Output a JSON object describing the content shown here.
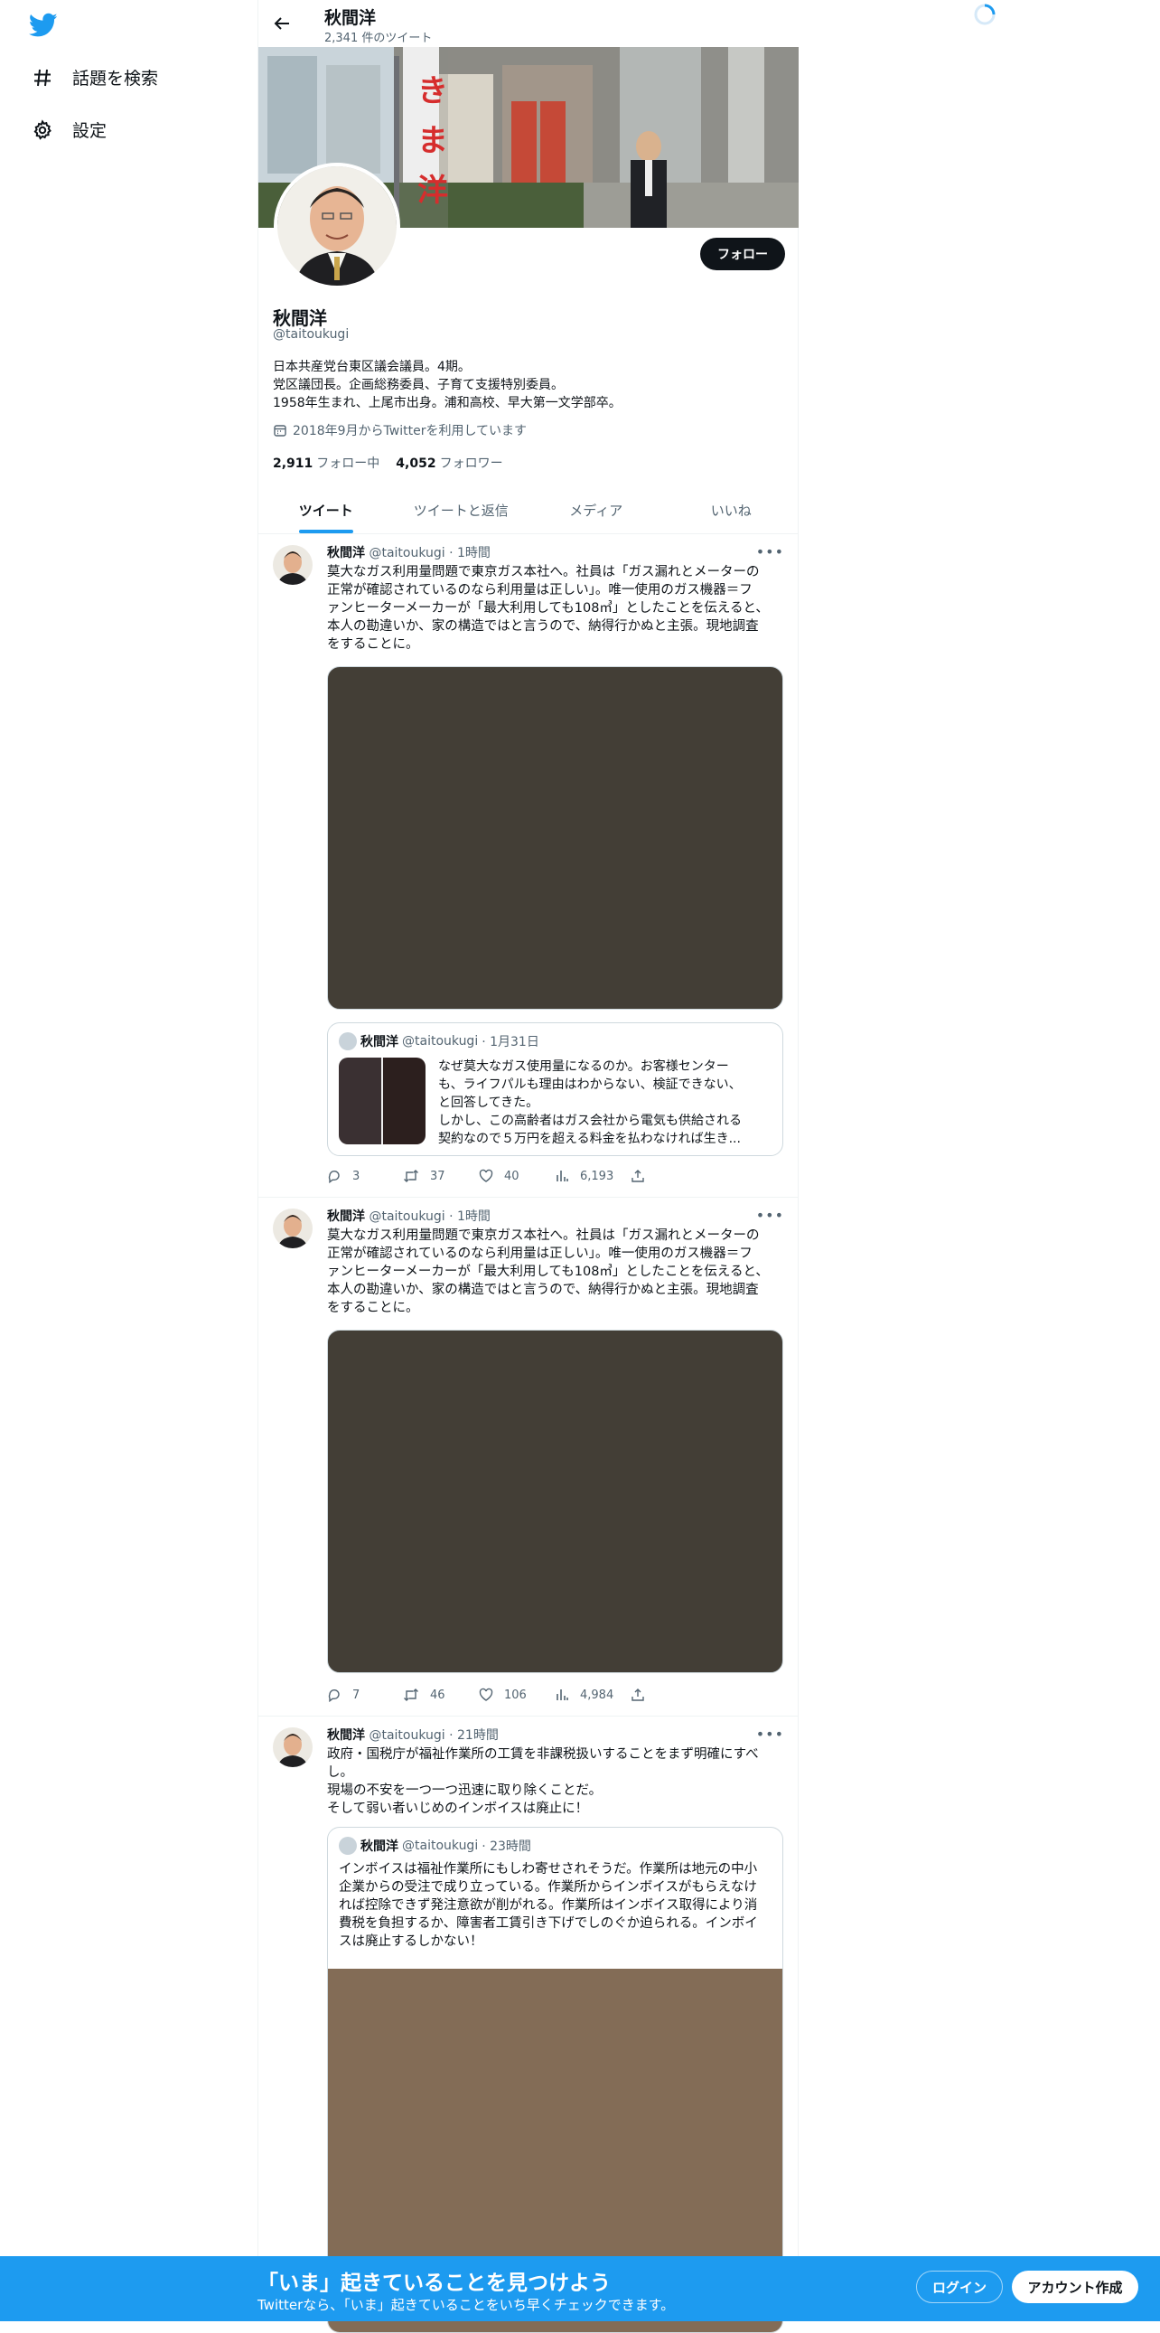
{
  "sidebar": {
    "items": [
      {
        "label": "話題を検索",
        "icon": "hashtag-icon"
      },
      {
        "label": "設定",
        "icon": "gear-icon"
      }
    ]
  },
  "header": {
    "name": "秋間洋",
    "tweet_count": "2,341 件のツイート"
  },
  "profile": {
    "follow_label": "フォロー",
    "name": "秋間洋",
    "handle": "@taitoukugi",
    "bio": [
      "日本共産党台東区議会議員。4期。",
      "党区議団長。企画総務委員、子育て支援特別委員。",
      "1958年生まれ、上尾市出身。浦和高校、早大第一文学部卒。"
    ],
    "joined": "2018年9月からTwitterを利用しています",
    "following_count": "2,911",
    "following_label": "フォロー中",
    "followers_count": "4,052",
    "followers_label": "フォロワー",
    "banner_flag_text": "き ま 洋"
  },
  "tabs": [
    {
      "label": "ツイート",
      "active": true
    },
    {
      "label": "ツイートと返信",
      "active": false
    },
    {
      "label": "メディア",
      "active": false
    },
    {
      "label": "いいね",
      "active": false
    }
  ],
  "tweets": [
    {
      "name": "秋間洋",
      "handle": "@taitoukugi",
      "time": "· 1時間",
      "lines": [
        "莫大なガス利用量問題で東京ガス本社へ。社員は「ガス漏れとメーターの",
        "正常が確認されているのなら利用量は正しい」。唯一使用のガス機器＝フ",
        "ァンヒーターメーカーが「最大利用しても108㎥」としたことを伝えると、",
        "本人の勘違いか、家の構造ではと言うので、納得行かぬと主張。現地調査",
        "をすることに。"
      ],
      "media_color": "#433e36",
      "quote": {
        "name": "秋間洋",
        "handle": "@taitoukugi",
        "time": "· 1月31日",
        "lines": [
          "なぜ莫大なガス使用量になるのか。お客様センター",
          "も、ライフパルも理由はわからない、検証できない、",
          "と回答してきた。",
          "しかし、この高齢者はガス会社から電気も供給される",
          "契約なので５万円を超える料金を払わなければ生き..."
        ]
      },
      "replies": "3",
      "retweets": "37",
      "likes": "40",
      "views": "6,193"
    },
    {
      "name": "秋間洋",
      "handle": "@taitoukugi",
      "time": "· 1時間",
      "lines": [
        "莫大なガス利用量問題で東京ガス本社へ。社員は「ガス漏れとメーターの",
        "正常が確認されているのなら利用量は正しい」。唯一使用のガス機器＝フ",
        "ァンヒーターメーカーが「最大利用しても108㎥」としたことを伝えると、",
        "本人の勘違いか、家の構造ではと言うので、納得行かぬと主張。現地調査",
        "をすることに。"
      ],
      "media_color": "#433e36",
      "replies": "7",
      "retweets": "46",
      "likes": "106",
      "views": "4,984"
    },
    {
      "name": "秋間洋",
      "handle": "@taitoukugi",
      "time": "· 21時間",
      "lines": [
        "政府・国税庁が福祉作業所の工賃を非課税扱いすることをまず明確にすべ",
        "し。",
        "現場の不安を一つ一つ迅速に取り除くことだ。",
        "そして弱い者いじめのインボイスは廃止に！"
      ],
      "quote": {
        "name": "秋間洋",
        "handle": "@taitoukugi",
        "time": "· 23時間",
        "lines": [
          "インボイスは福祉作業所にもしわ寄せされそうだ。作業所は地元の中小",
          "企業からの受注で成り立っている。作業所からインボイスがもらえなけ",
          "れば控除できず発注意欲が削がれる。作業所はインボイス取得により消",
          "費税を負担するか、障害者工賃引き下げでしのぐか迫られる。インボイ",
          "スは廃止するしかない！"
        ],
        "media_color": "#836c56"
      }
    }
  ],
  "bottom_bar": {
    "title": "「いま」起きていることを見つけよう",
    "subtitle": "Twitterなら、「いま」起きていることをいち早くチェックできます。",
    "login_label": "ログイン",
    "signup_label": "アカウント作成"
  },
  "colors": {
    "accent": "#1d9bf0",
    "text": "#0f1419",
    "secondary": "#536471"
  }
}
